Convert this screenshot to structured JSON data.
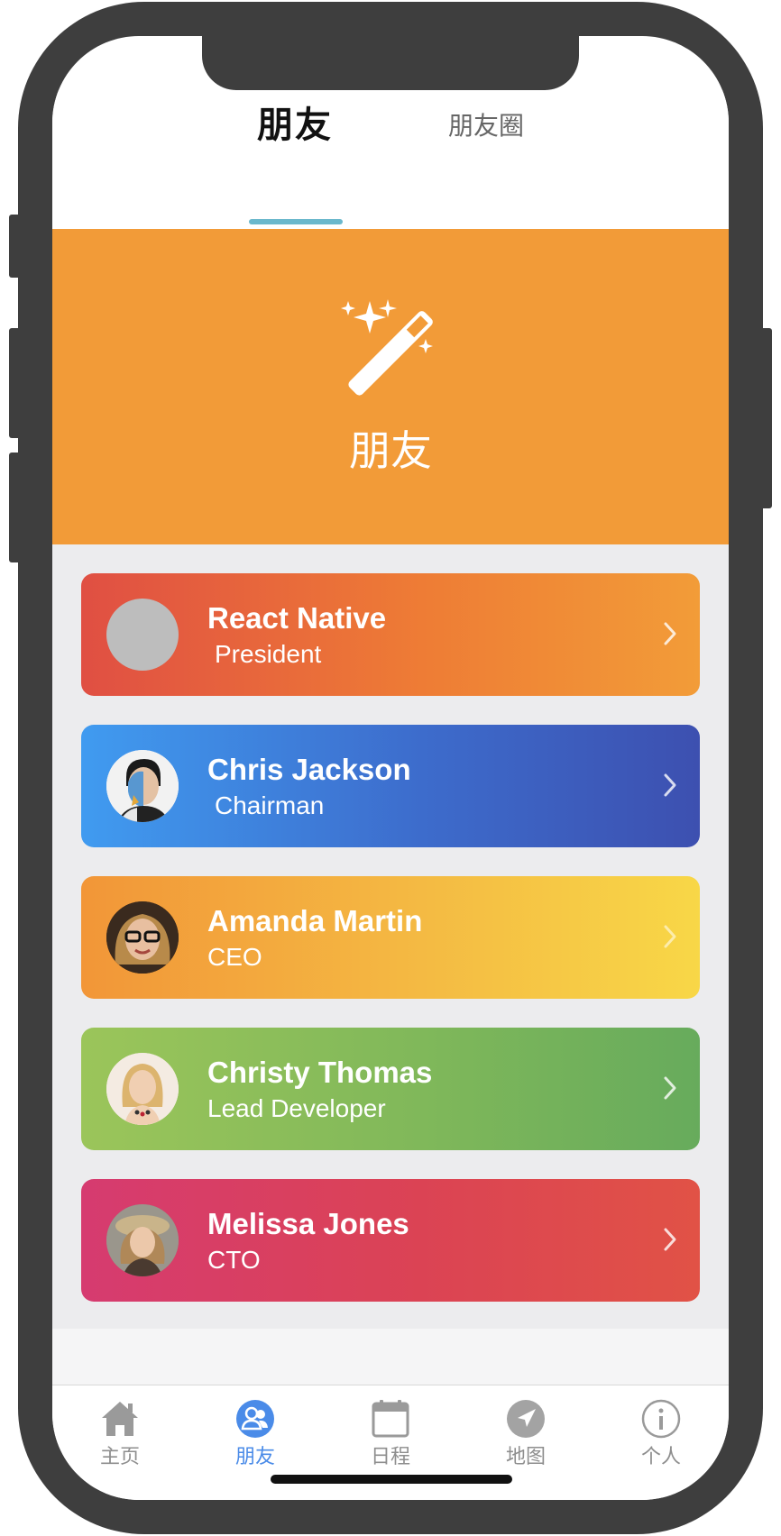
{
  "top_tabs": {
    "items": [
      {
        "label": "朋友",
        "active": true
      },
      {
        "label": "朋友圈",
        "active": false
      }
    ],
    "indicator_color": "#6bb8cc"
  },
  "hero": {
    "icon": "magic-wand-icon",
    "title": "朋友",
    "background_color": "#f29b38"
  },
  "friends": [
    {
      "name": "React Native",
      "role": "President",
      "avatar": "placeholder",
      "gradient": [
        "#e04f43",
        "#f29c38"
      ]
    },
    {
      "name": "Chris Jackson",
      "role": "Chairman",
      "avatar": "photo",
      "gradient": [
        "#409bf0",
        "#3d50b0"
      ]
    },
    {
      "name": "Amanda Martin",
      "role": "CEO",
      "avatar": "photo",
      "gradient": [
        "#f29638",
        "#f8d747"
      ]
    },
    {
      "name": "Christy Thomas",
      "role": "Lead Developer",
      "avatar": "photo",
      "gradient": [
        "#9bc55a",
        "#67ab5c"
      ]
    },
    {
      "name": "Melissa Jones",
      "role": "CTO",
      "avatar": "photo",
      "gradient": [
        "#d63b70",
        "#e15246"
      ]
    }
  ],
  "bottom_nav": {
    "items": [
      {
        "label": "主页",
        "icon": "home-icon",
        "active": false
      },
      {
        "label": "朋友",
        "icon": "people-icon",
        "active": true
      },
      {
        "label": "日程",
        "icon": "calendar-icon",
        "active": false
      },
      {
        "label": "地图",
        "icon": "location-arrow-icon",
        "active": false
      },
      {
        "label": "个人",
        "icon": "info-icon",
        "active": false
      }
    ],
    "active_color": "#4a8be8",
    "inactive_color": "#8e8e8e"
  }
}
